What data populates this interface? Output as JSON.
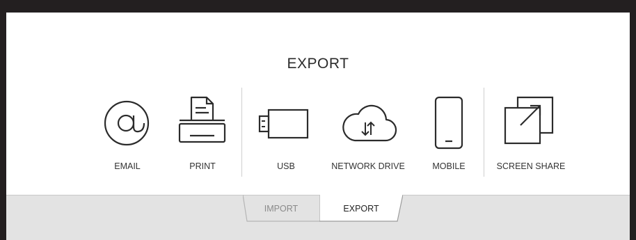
{
  "header": {
    "title": "EXPORT"
  },
  "options": {
    "email": "EMAIL",
    "print": "PRINT",
    "usb": "USB",
    "network_drive": "NETWORK DRIVE",
    "mobile": "MOBILE",
    "screen_share": "SCREEN SHARE"
  },
  "tabs": {
    "import": "IMPORT",
    "export": "EXPORT",
    "active": "EXPORT"
  },
  "colors": {
    "frame": "#231f20",
    "panel": "#ffffff",
    "tabbar": "#e3e3e3",
    "icon_stroke": "#2b2b2b"
  }
}
